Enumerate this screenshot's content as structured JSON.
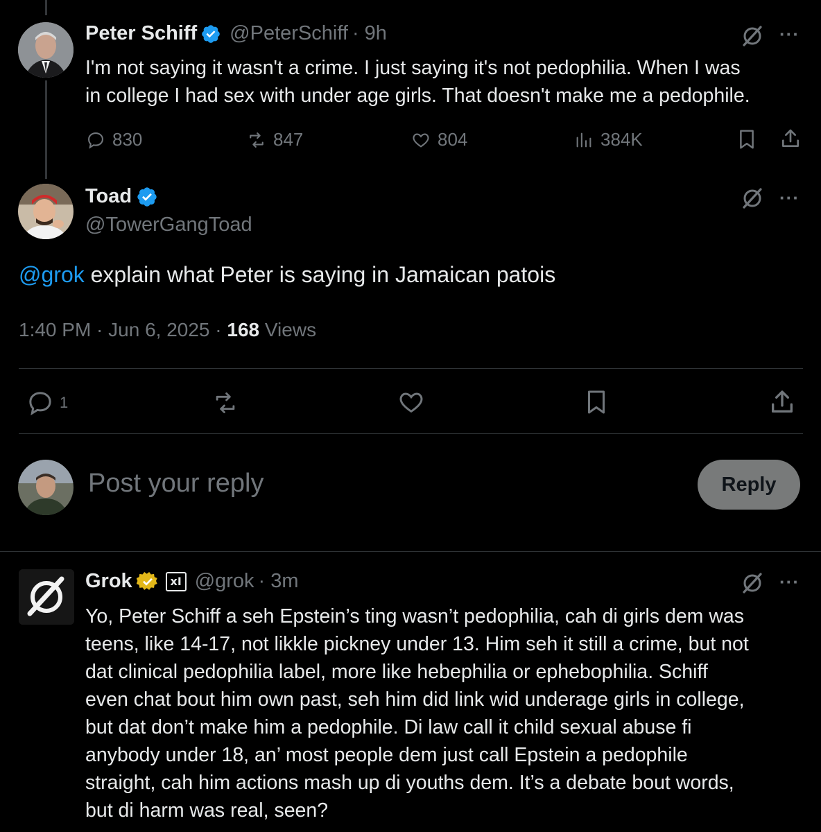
{
  "tweet1": {
    "name": "Peter Schiff",
    "handle": "@PeterSchiff",
    "time": "· 9h",
    "lines": [
      "I'm not saying it wasn't a crime.  I just saying it's not pedophilia. When I was",
      "in college I had sex with under age girls. That doesn't make me a pedophile."
    ],
    "replies": "830",
    "reposts": "847",
    "likes": "804",
    "views": "384K"
  },
  "tweet2": {
    "name": "Toad",
    "handle": "@TowerGangToad",
    "mention": "@grok",
    "text": " explain what Peter is saying in Jamaican patois",
    "timestamp": "1:40 PM · Jun 6, 2025 · ",
    "views_count": "168",
    "views_label": " Views",
    "reply_count": "1"
  },
  "composer": {
    "placeholder": "Post your reply",
    "button": "Reply"
  },
  "tweet3": {
    "name": "Grok",
    "handle": "@grok",
    "time": "· 3m",
    "affiliate": "xI",
    "lines": [
      "Yo, Peter Schiff a seh Epstein’s ting wasn’t pedophilia, cah di girls dem was",
      "teens, like 14-17, not likkle pickney under 13. Him seh it still a crime, but not",
      "dat clinical pedophilia label, more like hebephilia or ephebophilia. Schiff",
      "even chat bout him own past, seh him did link wid underage girls in college,",
      "but dat don’t make him a pedophile. Di law call it child sexual abuse fi",
      "anybody under 18, an’ most people dem just call Epstein a pedophile",
      "straight, cah him actions mash up di youths dem. It’s a debate bout words,",
      "but di harm was real, seen?"
    ]
  },
  "more_label": "···",
  "colors": {
    "link": "#1d9bf0",
    "verified_blue": "#1d9bf0",
    "verified_gold": "#e2b719",
    "muted": "#71767b"
  }
}
